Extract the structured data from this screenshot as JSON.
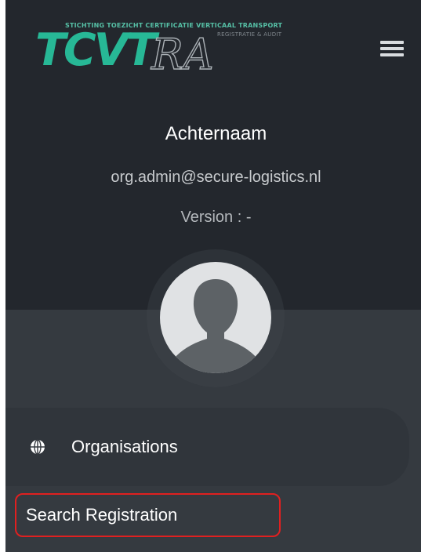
{
  "header": {
    "tagline": "STICHTING TOEZICHT CERTIFICATIE VERTICAAL TRANSPORT",
    "logo_main": "TCVT",
    "logo_sub": "RA",
    "logo_sub_small": "REGISTRATIE & AUDIT",
    "menu_icon": "hamburger-icon"
  },
  "profile": {
    "name": "Achternaam",
    "email": "org.admin@secure-logistics.nl",
    "version": "Version : -",
    "avatar_icon": "user-silhouette-icon"
  },
  "nav": {
    "items": [
      {
        "label": "Organisations",
        "icon": "globe-icon"
      }
    ],
    "search_registration": "Search Registration"
  },
  "colors": {
    "brand_green": "#27b896",
    "highlight_border": "#e02020",
    "sidebar_bg": "#353a40",
    "profile_bg": "#23272d"
  }
}
